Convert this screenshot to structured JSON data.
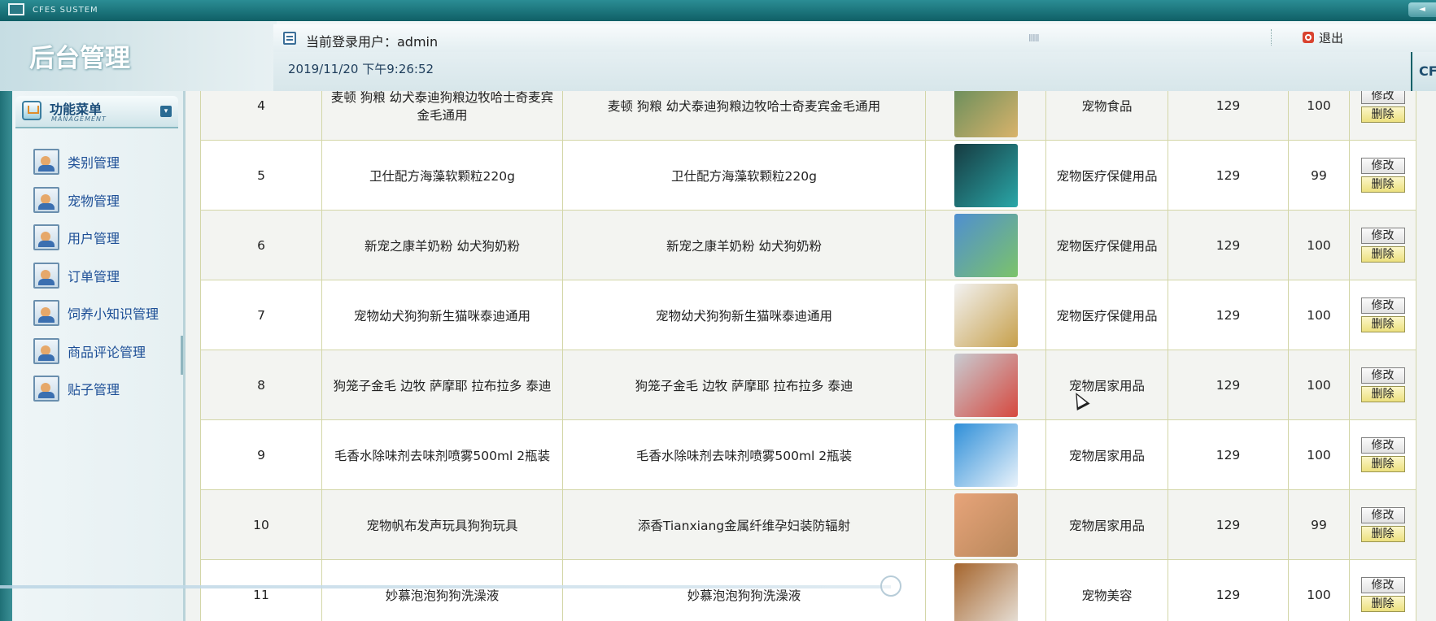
{
  "window": {
    "system_title": "CFES SUSTEM",
    "button_glyph": "◄"
  },
  "header": {
    "brand": "后台管理",
    "current_user_label": "当前登录用户：admin",
    "logout_label": "退出",
    "datetime": "2019/11/20 下午9:26:52",
    "right_tab": "CF",
    "grip": "IIIII"
  },
  "sidebar": {
    "title": "功能菜单",
    "subtitle": "MANAGEMENT",
    "collapse_glyph": "▾",
    "items": [
      {
        "label": "类别管理",
        "icon": "user-card-icon"
      },
      {
        "label": "宠物管理",
        "icon": "user-card-icon"
      },
      {
        "label": "用户管理",
        "icon": "user-card-icon"
      },
      {
        "label": "订单管理",
        "icon": "user-card-icon"
      },
      {
        "label": "饲养小知识管理",
        "icon": "user-card-icon"
      },
      {
        "label": "商品评论管理",
        "icon": "user-card-icon"
      },
      {
        "label": "贴子管理",
        "icon": "user-card-icon"
      }
    ]
  },
  "table": {
    "edit_label": "修改",
    "delete_label": "删除",
    "rows": [
      {
        "id": "4",
        "name": "麦顿 狗粮 幼犬泰迪狗粮边牧哈士奇麦宾金毛通用",
        "desc": "麦顿 狗粮 幼犬泰迪狗粮边牧哈士奇麦宾金毛通用",
        "category": "宠物食品",
        "price": "129",
        "stock": "100",
        "thumb_colors": [
          "#5d8a5a",
          "#d9b36b"
        ]
      },
      {
        "id": "5",
        "name": "卫仕配方海藻软颗粒220g",
        "desc": "卫仕配方海藻软颗粒220g",
        "category": "宠物医疗保健用品",
        "price": "129",
        "stock": "99",
        "thumb_colors": [
          "#163a40",
          "#2aa7a8"
        ]
      },
      {
        "id": "6",
        "name": "新宠之康羊奶粉 幼犬狗奶粉",
        "desc": "新宠之康羊奶粉 幼犬狗奶粉",
        "category": "宠物医疗保健用品",
        "price": "129",
        "stock": "100",
        "thumb_colors": [
          "#4f8fd0",
          "#7cc36a"
        ]
      },
      {
        "id": "7",
        "name": "宠物幼犬狗狗新生猫咪泰迪通用",
        "desc": "宠物幼犬狗狗新生猫咪泰迪通用",
        "category": "宠物医疗保健用品",
        "price": "129",
        "stock": "100",
        "thumb_colors": [
          "#f2f2f2",
          "#c7a04b"
        ]
      },
      {
        "id": "8",
        "name": "狗笼子金毛 边牧 萨摩耶 拉布拉多 泰迪",
        "desc": "狗笼子金毛 边牧 萨摩耶 拉布拉多 泰迪",
        "category": "宠物居家用品",
        "price": "129",
        "stock": "100",
        "thumb_colors": [
          "#c8ccd2",
          "#d6483e"
        ]
      },
      {
        "id": "9",
        "name": "毛香水除味剂去味剂喷雾500ml 2瓶装",
        "desc": "毛香水除味剂去味剂喷雾500ml 2瓶装",
        "category": "宠物居家用品",
        "price": "129",
        "stock": "100",
        "thumb_colors": [
          "#2f8fd8",
          "#eaf3fb"
        ]
      },
      {
        "id": "10",
        "name": "宠物帆布发声玩具狗狗玩具",
        "desc": "添香Tianxiang金属纤维孕妇装防辐射",
        "category": "宠物居家用品",
        "price": "129",
        "stock": "99",
        "thumb_colors": [
          "#e7a47a",
          "#b8875a"
        ]
      },
      {
        "id": "11",
        "name": "妙慕泡泡狗狗洗澡液",
        "desc": "妙慕泡泡狗狗洗澡液",
        "category": "宠物美容",
        "price": "129",
        "stock": "100",
        "thumb_colors": [
          "#a5652d",
          "#e8e2da"
        ]
      }
    ]
  }
}
